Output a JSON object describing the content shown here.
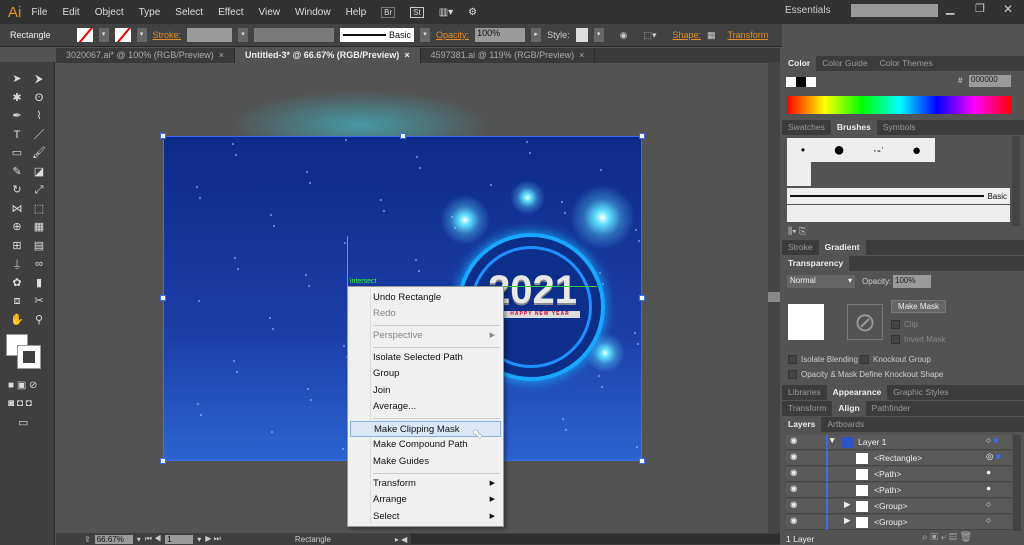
{
  "app": {
    "logo": "Ai",
    "menu": [
      "File",
      "Edit",
      "Object",
      "Type",
      "Select",
      "Effect",
      "View",
      "Window",
      "Help"
    ],
    "workspace": "Essentials"
  },
  "control": {
    "object_type": "Rectangle",
    "stroke_label": "Stroke:",
    "brush": "Basic",
    "opacity_label": "Opacity:",
    "opacity": "100%",
    "style_label": "Style:",
    "shape_label": "Shape:",
    "transform_label": "Transform"
  },
  "tabs": [
    {
      "label": "3020067.ai* @ 100% (RGB/Preview)"
    },
    {
      "label": "Untitled-3* @ 66.67% (RGB/Preview)",
      "active": true
    },
    {
      "label": "4597381.ai @ 119% (RGB/Preview)"
    }
  ],
  "canvas": {
    "smart_guide": "intersect",
    "year": "2021",
    "tagline": "HAPPY NEW YEAR"
  },
  "context_menu": {
    "items": [
      "Undo Rectangle",
      "Redo",
      "Perspective",
      "Isolate Selected Path",
      "Group",
      "Join",
      "Average...",
      "Make Clipping Mask",
      "Make Compound Path",
      "Make Guides",
      "Transform",
      "Arrange",
      "Select"
    ],
    "highlighted": "Make Clipping Mask"
  },
  "status": {
    "zoom": "66.67%",
    "artboard": "1",
    "tool": "Rectangle"
  },
  "panels": {
    "color_tabs": [
      "Color",
      "Color Guide",
      "Color Themes"
    ],
    "hex": "000000",
    "brush_tabs": [
      "Swatches",
      "Brushes",
      "Symbols"
    ],
    "brush_name": "Basic",
    "stroke_tabs": [
      "Stroke",
      "Gradient"
    ],
    "transparency": {
      "tab": "Transparency",
      "mode": "Normal",
      "opacity_label": "Opacity:",
      "opacity": "100%",
      "make_mask": "Make Mask",
      "clip": "Clip",
      "invert": "Invert Mask",
      "isolate": "Isolate Blending",
      "knockout": "Knockout Group",
      "define": "Opacity & Mask Define Knockout Shape"
    },
    "appearance_tabs": [
      "Libraries",
      "Appearance",
      "Graphic Styles"
    ],
    "align_tabs": [
      "Transform",
      "Align",
      "Pathfinder"
    ],
    "layers_tabs": [
      "Layers",
      "Artboards"
    ],
    "layers": [
      "Layer 1",
      "<Rectangle>",
      "<Path>",
      "<Path>",
      "<Group>",
      "<Group>"
    ],
    "layer_count": "1 Layer"
  },
  "colors": {
    "accent": "#e58d26",
    "selection": "#3b6cf0"
  }
}
